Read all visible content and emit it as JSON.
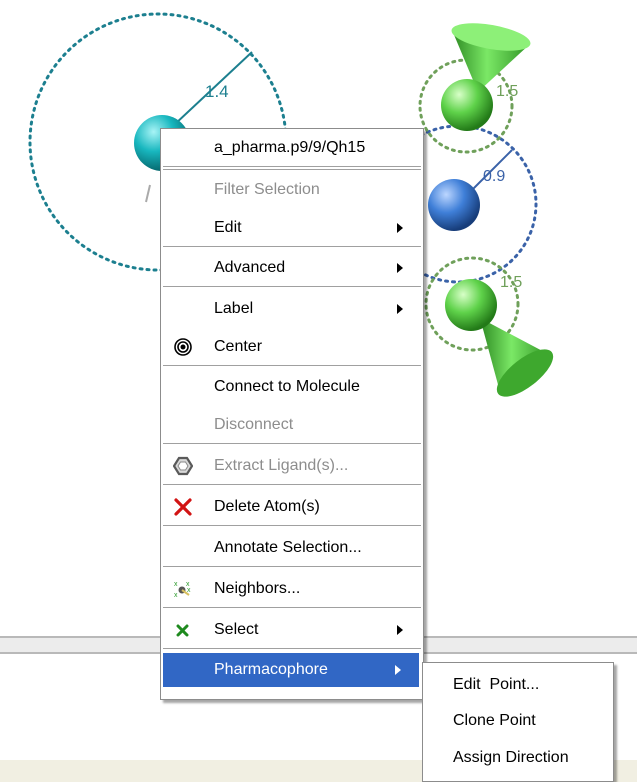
{
  "scene": {
    "distance_labels": [
      "1.4",
      "1.5",
      "0.9",
      "1.5"
    ],
    "colors": {
      "atom_cyan": "#18b7bf",
      "atom_blue": "#3f7fd8",
      "feature_green": "#5fd24a",
      "dotted_teal": "#1c7f8f",
      "dotted_green": "#6fa05a",
      "highlight": "#3167c5"
    }
  },
  "context_menu": {
    "title": "a_pharma.p9/9/Qh15",
    "items": {
      "filter_selection": "Filter Selection",
      "edit": "Edit",
      "advanced": "Advanced",
      "label": "Label",
      "center": "Center",
      "connect_to_molecule": "Connect to Molecule",
      "disconnect": "Disconnect",
      "extract_ligands": "Extract Ligand(s)...",
      "delete_atoms": "Delete Atom(s)",
      "annotate_selection": "Annotate Selection...",
      "neighbors": "Neighbors...",
      "select": "Select",
      "pharmacophore": "Pharmacophore"
    },
    "icons": {
      "center": "target-icon",
      "extract": "ligand-hexagon-icon",
      "delete": "red-x-icon",
      "neighbors": "neighbors-icon",
      "select": "green-x-icon"
    }
  },
  "submenu": {
    "items": [
      "Edit  Point...",
      "Clone Point",
      "Assign Direction"
    ]
  }
}
